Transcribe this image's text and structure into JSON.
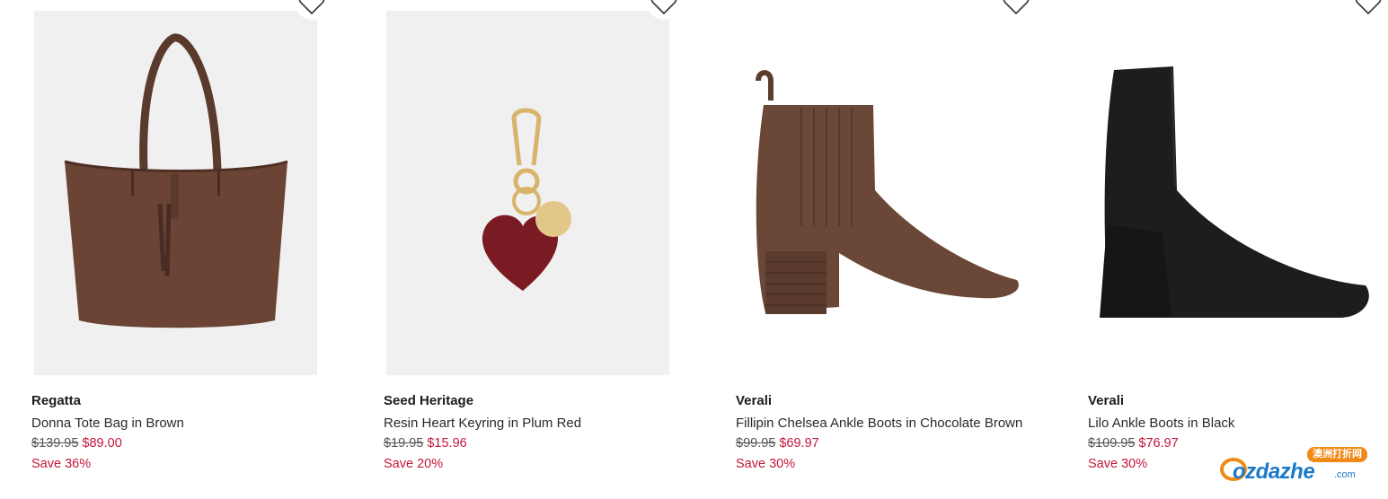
{
  "colors": {
    "sale_red": "#c4163c",
    "strike_grey": "#555555",
    "logo_orange": "#f08a17",
    "logo_blue": "#1b78c8"
  },
  "products": [
    {
      "brand": "Regatta",
      "name": "Donna Tote Bag in Brown",
      "old_price": "$139.95",
      "new_price": "$89.00",
      "save": "Save 36%",
      "image": "brown-tote-bag",
      "wishlist_icon": "heart-outline-icon"
    },
    {
      "brand": "Seed Heritage",
      "name": "Resin Heart Keyring in Plum Red",
      "old_price": "$19.95",
      "new_price": "$15.96",
      "save": "Save 20%",
      "image": "heart-keyring",
      "wishlist_icon": "heart-outline-icon"
    },
    {
      "brand": "Verali",
      "name": "Fillipin Chelsea Ankle Boots in Chocolate Brown",
      "old_price": "$99.95",
      "new_price": "$69.97",
      "save": "Save 30%",
      "image": "brown-chelsea-boot",
      "wishlist_icon": "heart-outline-icon"
    },
    {
      "brand": "Verali",
      "name": "Lilo Ankle Boots in Black",
      "old_price": "$109.95",
      "new_price": "$76.97",
      "save": "Save 30%",
      "image": "black-ankle-boot",
      "wishlist_icon": "heart-outline-icon"
    }
  ],
  "watermark": {
    "badge": "澳洲打折网",
    "word": "ozdazhe",
    "suffix": ".com"
  }
}
